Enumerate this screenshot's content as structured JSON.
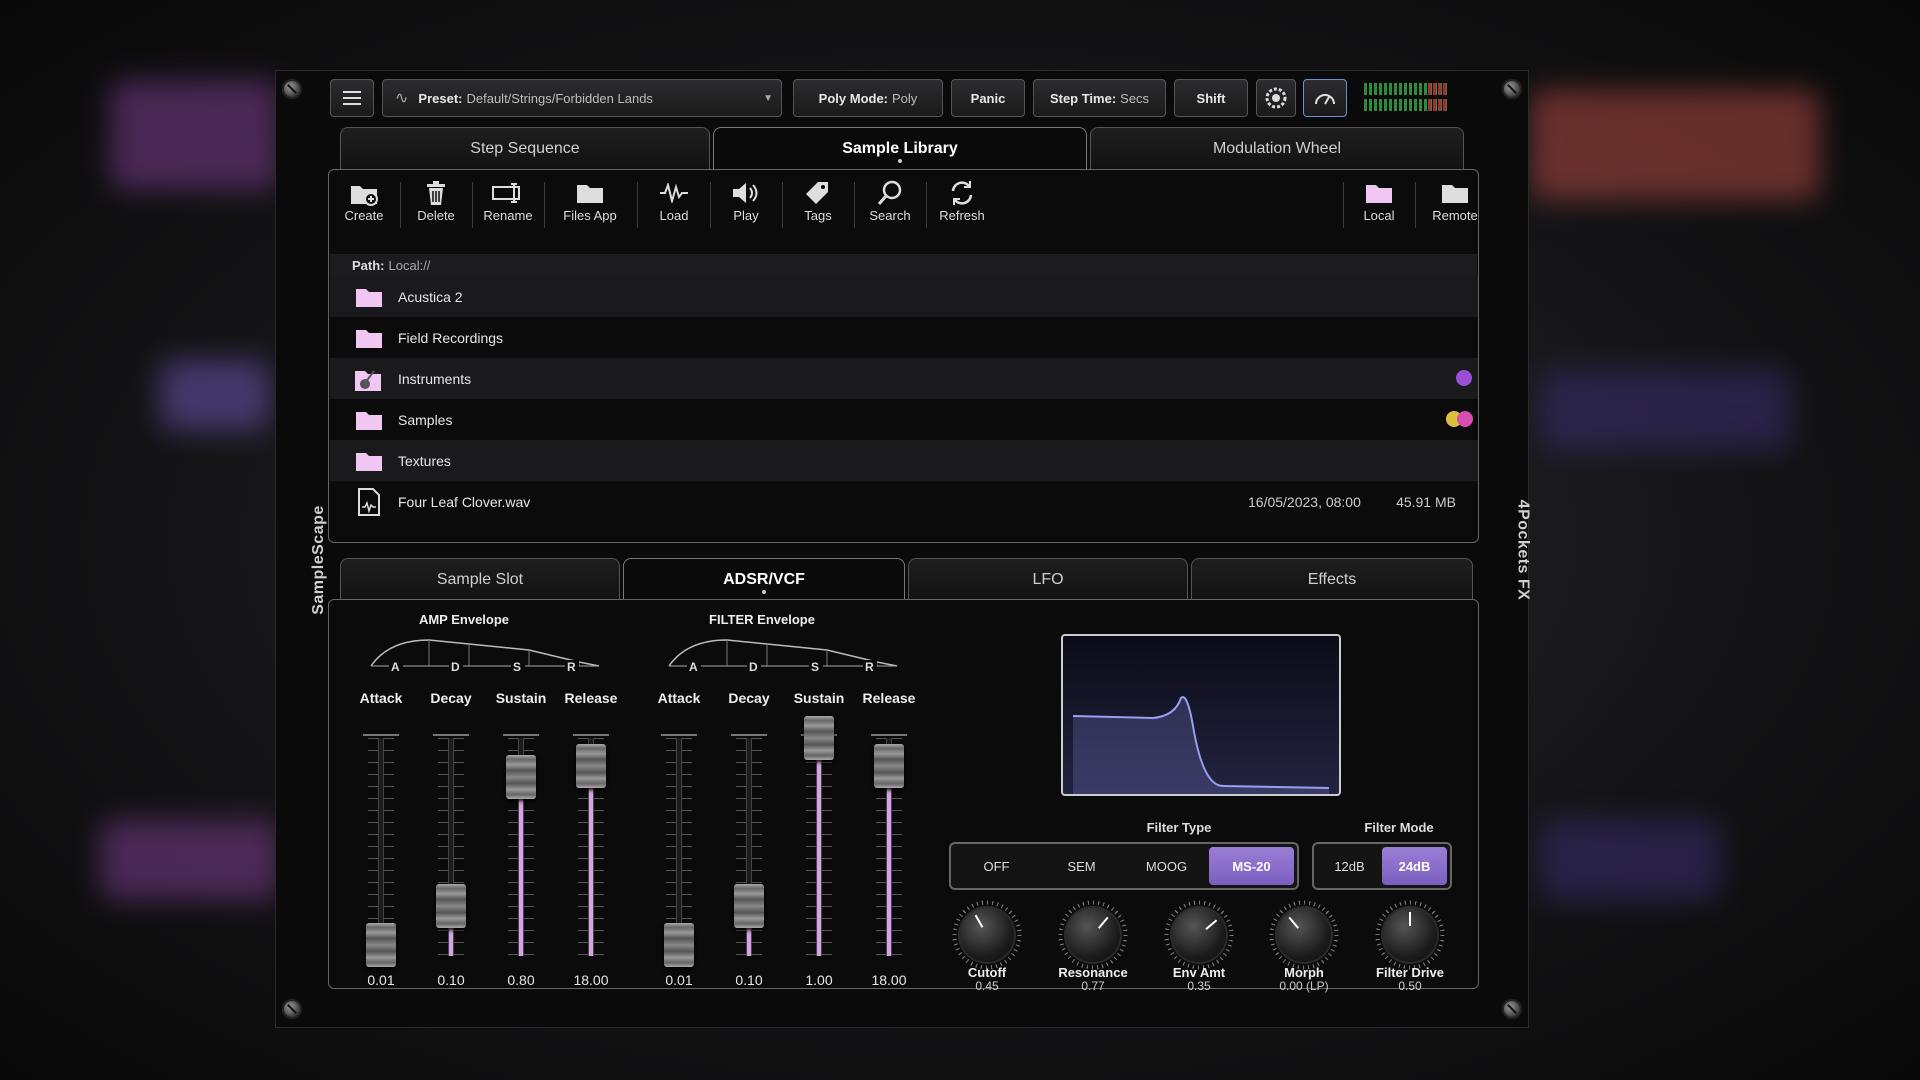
{
  "side": {
    "left": "SampleScape",
    "right": "4Pockets FX"
  },
  "toolbar": {
    "preset_label": "Preset:",
    "preset_value": "Default/Strings/Forbidden Lands",
    "poly_label": "Poly Mode:",
    "poly_value": "Poly",
    "panic": "Panic",
    "step_label": "Step Time:",
    "step_value": "Secs",
    "shift": "Shift"
  },
  "top_tabs": [
    "Step Sequence",
    "Sample Library",
    "Modulation Wheel"
  ],
  "library_tools": [
    "Create",
    "Delete",
    "Rename",
    "Files App",
    "Load",
    "Play",
    "Tags",
    "Search",
    "Refresh",
    "Local",
    "Remote"
  ],
  "path": {
    "label": "Path:",
    "value": "Local://"
  },
  "files": [
    {
      "name": "Acustica 2",
      "icon": "folder-icon",
      "date": "",
      "size": ""
    },
    {
      "name": "Field Recordings",
      "icon": "folder-icon",
      "date": "",
      "size": ""
    },
    {
      "name": "Instruments",
      "icon": "instrument-folder-icon",
      "date": "",
      "size": ""
    },
    {
      "name": "Samples",
      "icon": "folder-icon",
      "date": "",
      "size": ""
    },
    {
      "name": "Textures",
      "icon": "folder-icon",
      "date": "",
      "size": ""
    },
    {
      "name": "Four Leaf Clover.wav",
      "icon": "audio-file-icon",
      "date": "16/05/2023, 08:00",
      "size": "45.91 MB"
    }
  ],
  "tag_colors": {
    "instruments": [
      "#9b4fd6"
    ],
    "samples": [
      "#d9c23a",
      "#d64fb0"
    ]
  },
  "bottom_tabs": [
    "Sample Slot",
    "ADSR/VCF",
    "LFO",
    "Effects"
  ],
  "amp": {
    "title": "AMP Envelope",
    "labels": [
      "Attack",
      "Decay",
      "Sustain",
      "Release"
    ],
    "values": [
      "0.01",
      "0.10",
      "0.80",
      "18.00"
    ],
    "levels": [
      0.05,
      0.23,
      0.82,
      0.87
    ]
  },
  "filter_env": {
    "title": "FILTER Envelope",
    "labels": [
      "Attack",
      "Decay",
      "Sustain",
      "Release"
    ],
    "values": [
      "0.01",
      "0.10",
      "1.00",
      "18.00"
    ],
    "levels": [
      0.05,
      0.23,
      1.0,
      0.87
    ]
  },
  "adsr_letters": [
    "A",
    "D",
    "S",
    "R"
  ],
  "filter_type": {
    "title": "Filter Type",
    "options": [
      "OFF",
      "SEM",
      "MOOG",
      "MS-20"
    ],
    "selected": "MS-20"
  },
  "filter_mode": {
    "title": "Filter Mode",
    "options": [
      "12dB",
      "24dB"
    ],
    "selected": "24dB"
  },
  "knobs": [
    {
      "name": "Cutoff",
      "value": "0.45"
    },
    {
      "name": "Resonance",
      "value": "0.77"
    },
    {
      "name": "Env Amt",
      "value": "0.35"
    },
    {
      "name": "Morph",
      "value": "0.00 (LP)"
    },
    {
      "name": "Filter Drive",
      "value": "0.50"
    }
  ],
  "colors": {
    "accent": "#8c6fd0",
    "fader_fill": "#d7a3e6",
    "folder": "#f2c6f2"
  }
}
